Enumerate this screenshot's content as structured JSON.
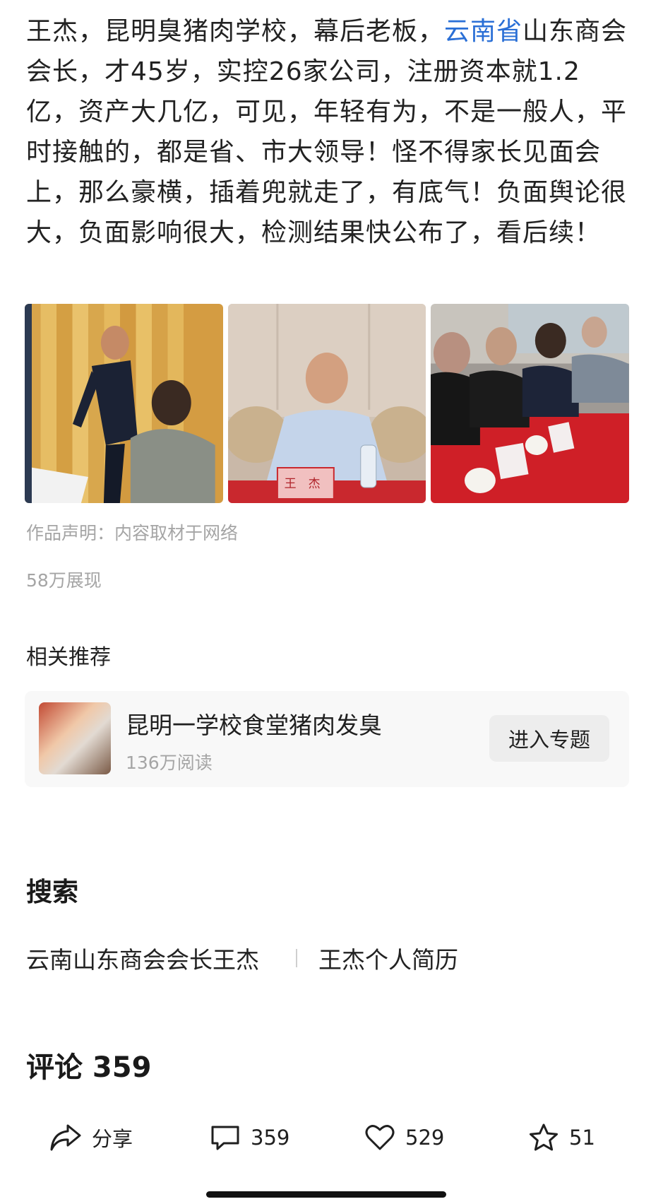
{
  "post": {
    "text_before_link": "王杰，昆明臭猪肉学校，幕后老板，",
    "link_text": "云南省",
    "text_after_link": "山东商会会长，才45岁，实控26家公司，注册资本就1.2亿，资产大几亿，可见，年轻有为，不是一般人，平时接触的，都是省、市大领导！怪不得家长见面会上，那么豪横，插着兜就走了，有底气！负面舆论很大，负面影响很大，检测结果快公布了，看后续！",
    "link_color": "#2a6fd6"
  },
  "images": {
    "img2_nameplate": "王　杰"
  },
  "meta": {
    "statement": "作品声明：内容取材于网络",
    "views": "58万展现"
  },
  "related": {
    "title": "相关推荐",
    "topic_title": "昆明一学校食堂猪肉发臭",
    "topic_reads": "136万阅读",
    "button_label": "进入专题"
  },
  "search": {
    "heading": "搜索",
    "items": [
      "云南山东商会会长王杰",
      "王杰个人简历"
    ]
  },
  "comments": {
    "heading": "评论 359"
  },
  "actions": {
    "share_label": "分享",
    "comment_count": "359",
    "like_count": "529",
    "favorite_count": "51"
  }
}
